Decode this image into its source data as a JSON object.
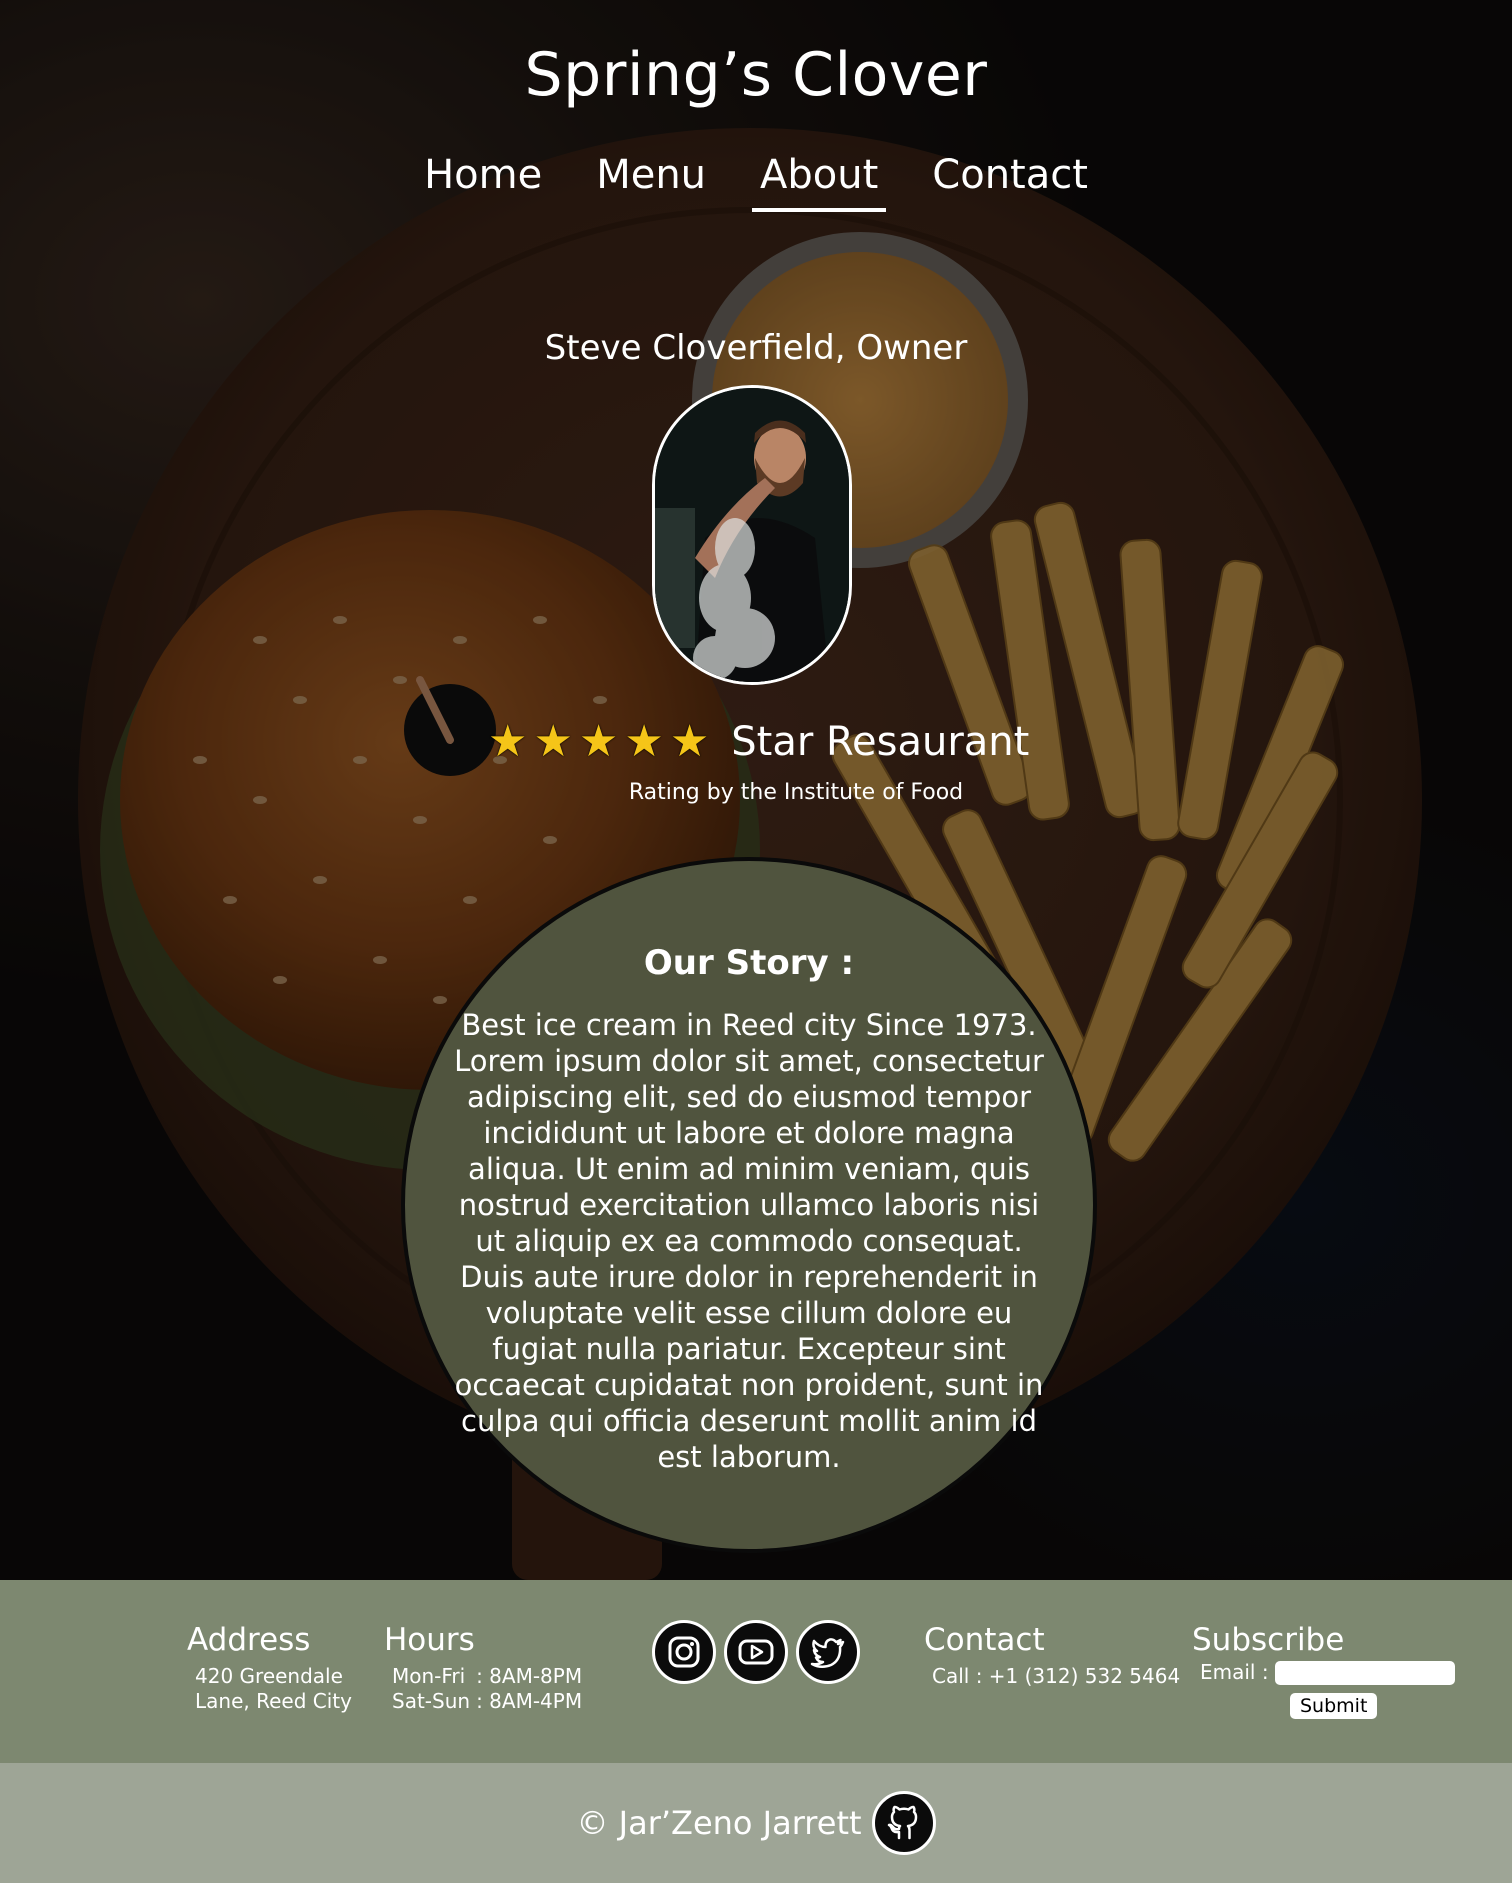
{
  "site": {
    "title": "Spring’s Clover"
  },
  "nav": {
    "items": [
      {
        "label": "Home"
      },
      {
        "label": "Menu"
      },
      {
        "label": "About",
        "active": true
      },
      {
        "label": "Contact"
      }
    ]
  },
  "owner": {
    "name": "Steve Cloverfield, Owner",
    "photo_icon": "chef-portrait"
  },
  "rating": {
    "stars": 5,
    "star_glyph": "★",
    "label": "Star Resaurant",
    "source": "Rating by the Institute of Food"
  },
  "story": {
    "title": "Our Story :",
    "body": "Best ice cream in Reed city Since 1973. Lorem ipsum dolor sit amet, consectetur adipiscing elit, sed do eiusmod tempor incididunt ut labore et dolore magna aliqua. Ut enim ad minim veniam, quis nostrud exercitation ullamco laboris nisi ut aliquip ex ea commodo consequat. Duis aute irure dolor in reprehenderit in voluptate velit esse cillum dolore eu fugiat nulla pariatur. Excepteur sint occaecat cupidatat non proident, sunt in culpa qui officia deserunt mollit anim id est laborum."
  },
  "footer": {
    "address": {
      "heading": "Address",
      "line1": "420 Greendale",
      "line2": "Lane, Reed City"
    },
    "hours": {
      "heading": "Hours",
      "rows": [
        {
          "days": "Mon-Fri",
          "time": ": 8AM-8PM"
        },
        {
          "days": "Sat-Sun",
          "time": ": 8AM-4PM"
        }
      ]
    },
    "socials": [
      "instagram-icon",
      "youtube-icon",
      "twitter-icon"
    ],
    "contact": {
      "heading": "Contact",
      "phone": "Call : +1 (312) 532 5464"
    },
    "subscribe": {
      "heading": "Subscribe",
      "email_label": "Email :",
      "email_value": "",
      "submit_label": "Submit"
    }
  },
  "bottom": {
    "copyright": "© Jar’Zeno Jarrett",
    "github_icon": "github-icon"
  },
  "colors": {
    "footer_bg": "#7d8870",
    "bottom_bg": "#9ea596",
    "story_bg": "#50543e",
    "star": "#f5c518"
  }
}
